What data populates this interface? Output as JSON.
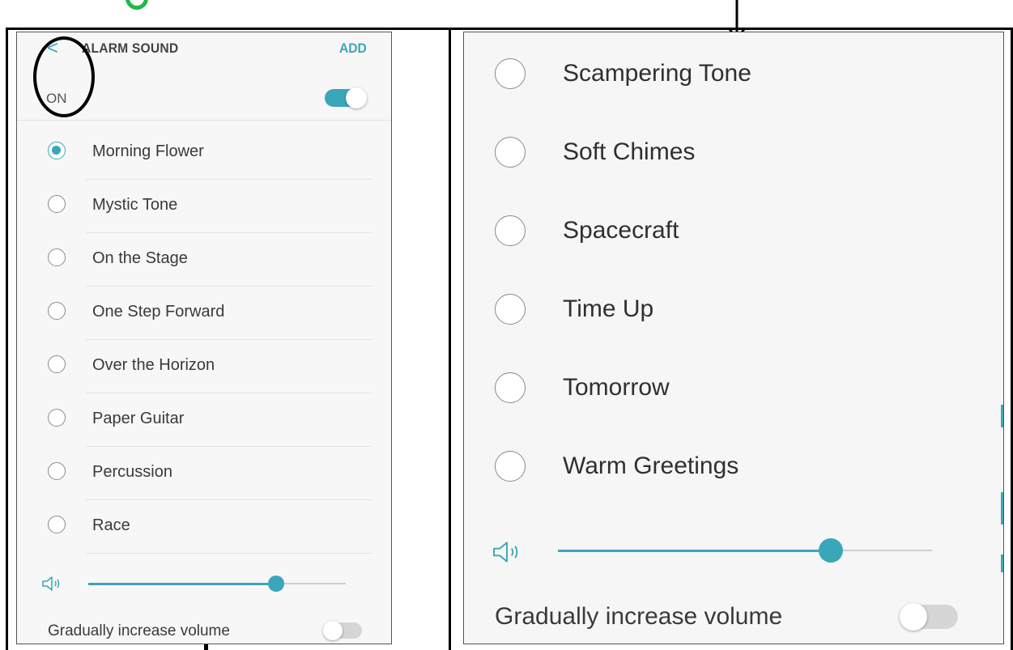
{
  "colors": {
    "accent": "#3aa6b9",
    "annotation_green": "#1fb84a",
    "annotation_black": "#000000"
  },
  "left_screen": {
    "header": {
      "back_icon": "chevron-left-icon",
      "back_glyph": "<",
      "title": "ALARM SOUND",
      "add_label": "ADD"
    },
    "on_row": {
      "label": "ON",
      "toggle_on": true
    },
    "sounds": [
      {
        "name": "Morning Flower",
        "selected": true
      },
      {
        "name": "Mystic Tone",
        "selected": false
      },
      {
        "name": "On the Stage",
        "selected": false
      },
      {
        "name": "One Step Forward",
        "selected": false
      },
      {
        "name": "Over the Horizon",
        "selected": false
      },
      {
        "name": "Paper Guitar",
        "selected": false
      },
      {
        "name": "Percussion",
        "selected": false
      },
      {
        "name": "Race",
        "selected": false
      }
    ],
    "volume": {
      "icon": "speaker-icon",
      "level": 0.73
    },
    "gradual": {
      "label": "Gradually increase volume",
      "toggle_on": false
    }
  },
  "right_screen": {
    "sounds": [
      {
        "name": "Scampering Tone",
        "selected": false
      },
      {
        "name": "Soft Chimes",
        "selected": false
      },
      {
        "name": "Spacecraft",
        "selected": false
      },
      {
        "name": "Time Up",
        "selected": false
      },
      {
        "name": "Tomorrow",
        "selected": false
      },
      {
        "name": "Warm Greetings",
        "selected": false
      }
    ],
    "volume": {
      "icon": "speaker-icon",
      "level": 0.73
    },
    "gradual": {
      "label": "Gradually increase volume",
      "toggle_on": false
    }
  },
  "annotations": {
    "circle_marker": "black-circle-annotation",
    "down_arrow": "down-arrow-annotation"
  }
}
